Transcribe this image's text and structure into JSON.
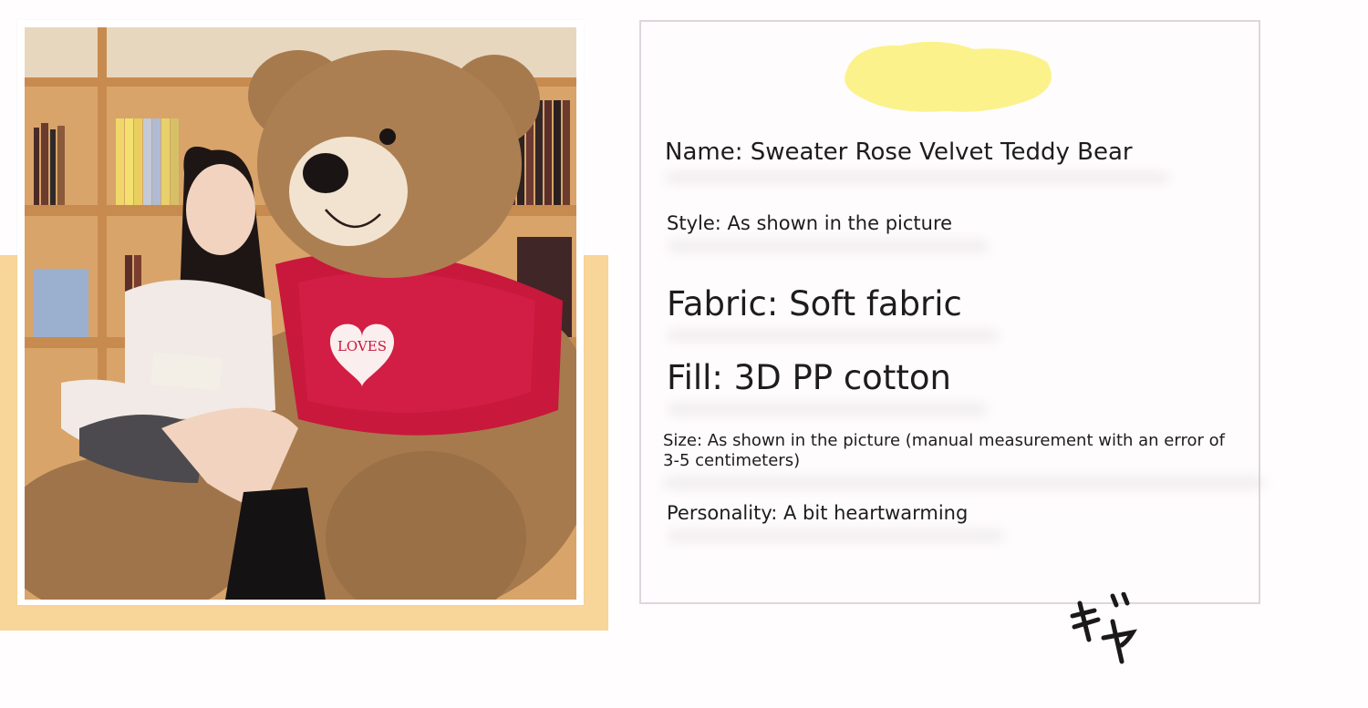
{
  "product": {
    "name": "Name: Sweater Rose Velvet Teddy Bear",
    "style": "Style: As shown in the picture",
    "fabric": "Fabric: Soft fabric",
    "fill": "Fill: 3D PP cotton",
    "size": "Size: As shown in the picture (manual measurement with an error of 3-5 centimeters)",
    "personality": "Personality: A bit heartwarming"
  },
  "photo": {
    "sweater_text": "LOVES"
  },
  "decor": {
    "scribble_icon": "gya-katakana-scribble",
    "accent_orange": "#f8d598",
    "accent_yellow": "#fbf28c",
    "sweater_red": "#c8183c",
    "bear_brown": "#a77a4e"
  }
}
